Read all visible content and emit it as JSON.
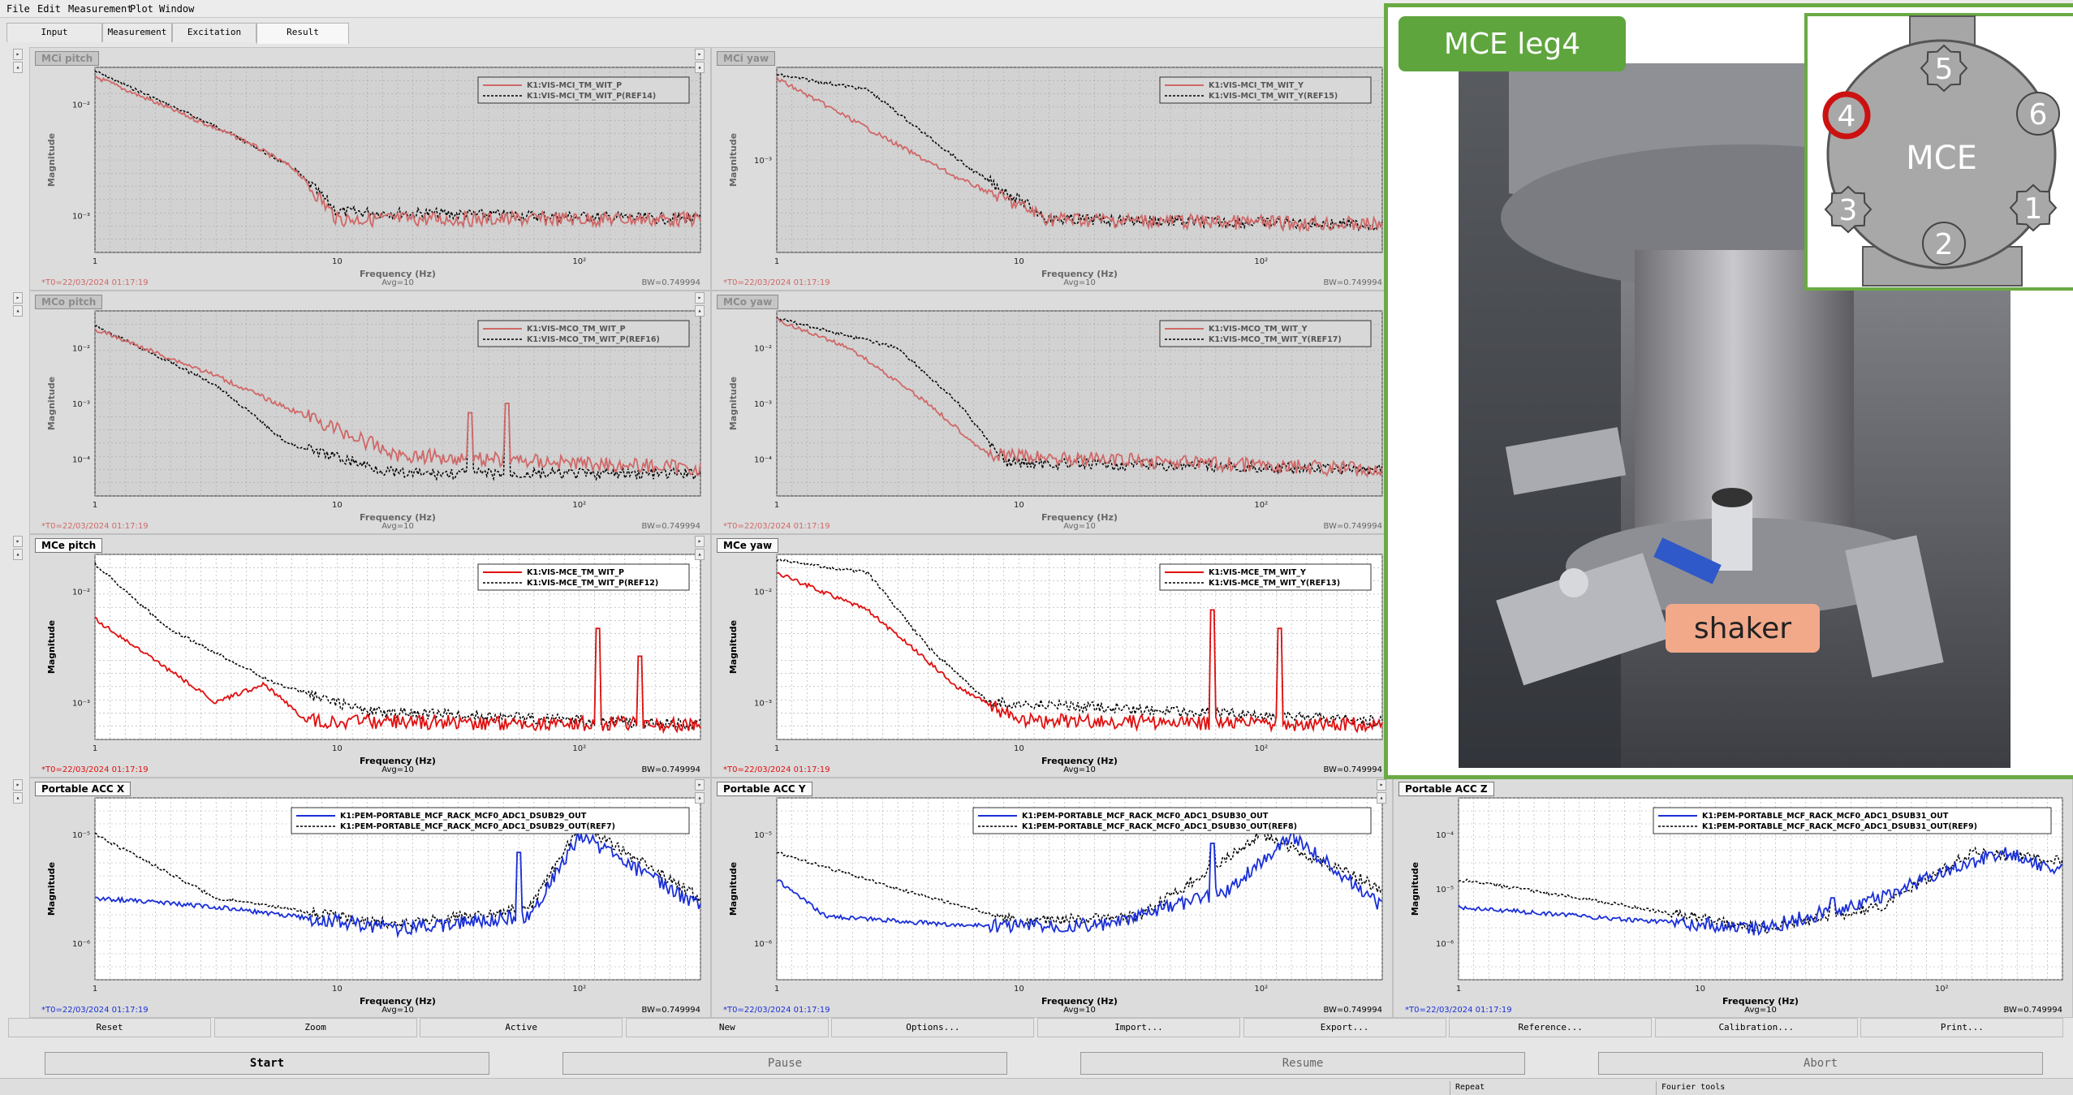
{
  "menu": [
    "File",
    "Edit",
    "Measurement",
    "Plot",
    "Window"
  ],
  "tabs": [
    "Input",
    "Measurement",
    "Excitation",
    "Result"
  ],
  "common": {
    "xlabel": "Frequency (Hz)",
    "ylabel": "Magnitude",
    "avg": "Avg=10",
    "bw": "BW=0.749994",
    "t0": "*T0=22/03/2024 01:17:19"
  },
  "colors": {
    "red": "#e01010",
    "blue": "#1a2fd8",
    "grey_red": "#d06868",
    "ref": "#000000",
    "grid": "#a8a8a8",
    "photo_border": "#6aaa44"
  },
  "plots": [
    {
      "title": "MCi pitch",
      "style": "grey",
      "legend": [
        "K1:VIS-MCI_TM_WIT_P",
        "K1:VIS-MCI_TM_WIT_P(REF14)"
      ],
      "color": "red",
      "xticks": [
        "1",
        "10",
        "10²"
      ],
      "yticks": [
        "10⁻²",
        "10⁻³"
      ]
    },
    {
      "title": "MCi yaw",
      "style": "grey",
      "legend": [
        "K1:VIS-MCI_TM_WIT_Y",
        "K1:VIS-MCI_TM_WIT_Y(REF15)"
      ],
      "color": "red",
      "xticks": [
        "1",
        "10",
        "10²"
      ],
      "yticks": [
        "10⁻³"
      ]
    },
    {
      "title": "MCo pitch",
      "style": "grey",
      "legend": [
        "K1:VIS-MCO_TM_WIT_P",
        "K1:VIS-MCO_TM_WIT_P(REF16)"
      ],
      "color": "red",
      "xticks": [
        "1",
        "10",
        "10²"
      ],
      "yticks": [
        "10⁻²",
        "10⁻³",
        "10⁻⁴"
      ]
    },
    {
      "title": "MCo yaw",
      "style": "grey",
      "legend": [
        "K1:VIS-MCO_TM_WIT_Y",
        "K1:VIS-MCO_TM_WIT_Y(REF17)"
      ],
      "color": "red",
      "xticks": [
        "1",
        "10",
        "10²"
      ],
      "yticks": [
        "10⁻²",
        "10⁻³",
        "10⁻⁴"
      ]
    },
    {
      "title": "MCe pitch",
      "style": "white",
      "legend": [
        "K1:VIS-MCE_TM_WIT_P",
        "K1:VIS-MCE_TM_WIT_P(REF12)"
      ],
      "color": "red",
      "xticks": [
        "1",
        "10",
        "10²"
      ],
      "yticks": [
        "10⁻²",
        "10⁻³"
      ]
    },
    {
      "title": "MCe yaw",
      "style": "white",
      "legend": [
        "K1:VIS-MCE_TM_WIT_Y",
        "K1:VIS-MCE_TM_WIT_Y(REF13)"
      ],
      "color": "red",
      "xticks": [
        "1",
        "10",
        "10²"
      ],
      "yticks": [
        "10⁻²",
        "10⁻³"
      ]
    },
    {
      "title": "Portable ACC X",
      "style": "white",
      "legend": [
        "K1:PEM-PORTABLE_MCF_RACK_MCF0_ADC1_DSUB29_OUT",
        "K1:PEM-PORTABLE_MCF_RACK_MCF0_ADC1_DSUB29_OUT(REF7)"
      ],
      "color": "blue",
      "xticks": [
        "1",
        "10",
        "10²"
      ],
      "yticks": [
        "10⁻⁵",
        "10⁻⁶"
      ]
    },
    {
      "title": "Portable ACC Y",
      "style": "white",
      "legend": [
        "K1:PEM-PORTABLE_MCF_RACK_MCF0_ADC1_DSUB30_OUT",
        "K1:PEM-PORTABLE_MCF_RACK_MCF0_ADC1_DSUB30_OUT(REF8)"
      ],
      "color": "blue",
      "xticks": [
        "1",
        "10",
        "10²"
      ],
      "yticks": [
        "10⁻⁵",
        "10⁻⁶"
      ]
    },
    {
      "title": "Portable ACC Z",
      "style": "white",
      "legend": [
        "K1:PEM-PORTABLE_MCF_RACK_MCF0_ADC1_DSUB31_OUT",
        "K1:PEM-PORTABLE_MCF_RACK_MCF0_ADC1_DSUB31_OUT(REF9)"
      ],
      "color": "blue",
      "xticks": [
        "1",
        "10",
        "10²"
      ],
      "yticks": [
        "10⁻⁴",
        "10⁻⁵",
        "10⁻⁶"
      ]
    }
  ],
  "photo": {
    "label": "MCE leg4",
    "shaker": "shaker",
    "diagram_center": "MCE",
    "legs": [
      "1",
      "2",
      "3",
      "4",
      "5",
      "6"
    ],
    "highlighted_leg": "4"
  },
  "buttons": [
    "Reset",
    "Zoom",
    "Active",
    "New",
    "Options...",
    "Import...",
    "Export...",
    "Reference...",
    "Calibration...",
    "Print..."
  ],
  "controls": [
    "Start",
    "Pause",
    "Resume",
    "Abort"
  ],
  "status": [
    "Repeat",
    "Fourier tools"
  ]
}
